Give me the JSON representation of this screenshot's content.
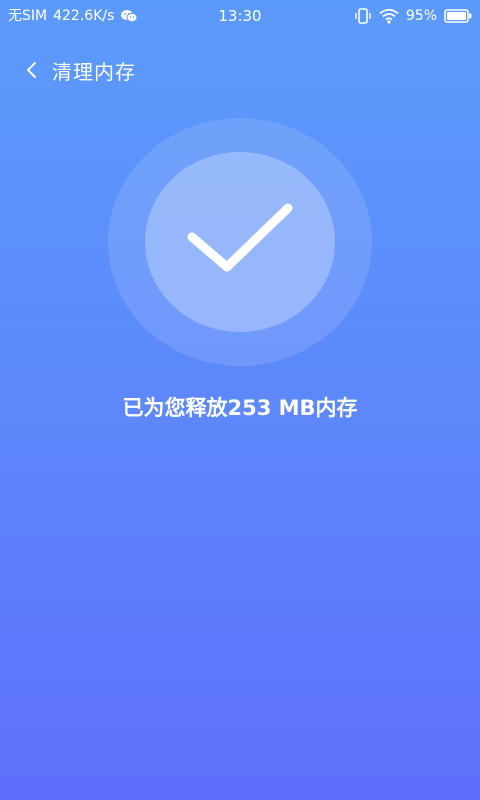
{
  "status_bar": {
    "carrier": "无SIM",
    "speed": "422.6K/s",
    "time": "13:30",
    "battery_percent": "95%",
    "icons": [
      "wechat-icon",
      "vibrate-icon",
      "wifi-icon",
      "battery-icon"
    ]
  },
  "header": {
    "back_icon": "chevron-left-icon",
    "title": "清理内存"
  },
  "result": {
    "icon": "checkmark-icon",
    "message": "已为您释放253 MB内存"
  },
  "colors": {
    "background_top": "#5b9bfb",
    "background_bottom": "#5e6ffb",
    "text": "#ffffff"
  }
}
